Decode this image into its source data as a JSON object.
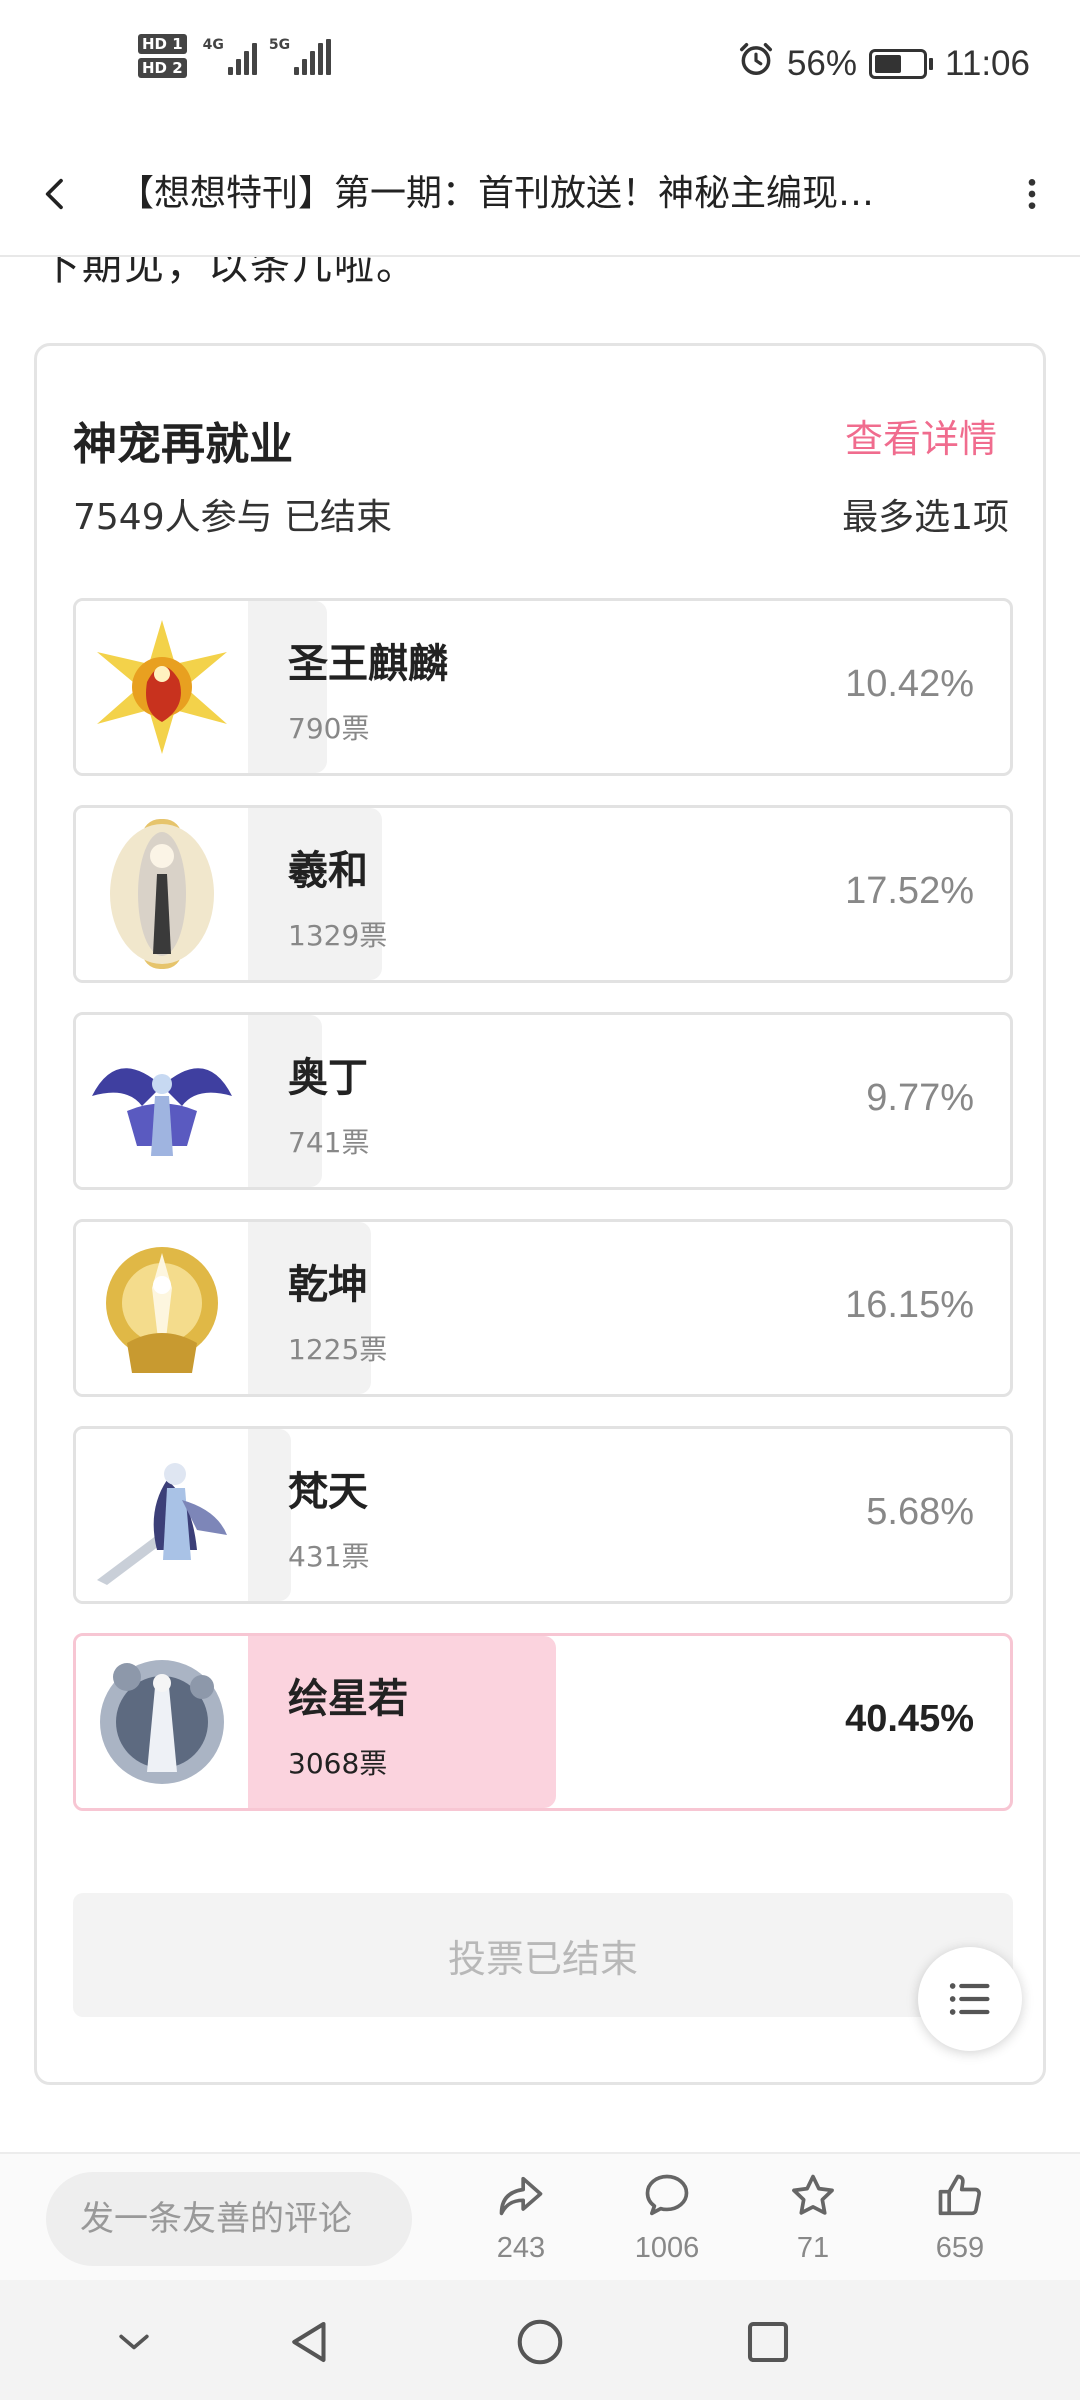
{
  "status_bar": {
    "sim1": "HD 1",
    "sim2": "HD 2",
    "net1": "4G",
    "net2": "5G",
    "battery_pct": "56%",
    "battery_level": 0.56,
    "time": "11:06",
    "icons": [
      "alarm-icon",
      "battery-icon",
      "signal-icon"
    ]
  },
  "header": {
    "title": "【想想特刊】第一期：首刊放送！神秘主编现…"
  },
  "content": {
    "cut_text": "下期见，以条几啦。"
  },
  "poll": {
    "title": "神宠再就业",
    "detail_link": "查看详情",
    "participants": "7549人参与 已结束",
    "rule": "最多选1项",
    "options": [
      {
        "name": "圣王麒麟",
        "votes": "790票",
        "percent": "10.42%",
        "share": 0.1042
      },
      {
        "name": "羲和",
        "votes": "1329票",
        "percent": "17.52%",
        "share": 0.1752
      },
      {
        "name": "奥丁",
        "votes": "741票",
        "percent": "9.77%",
        "share": 0.0977
      },
      {
        "name": "乾坤",
        "votes": "1225票",
        "percent": "16.15%",
        "share": 0.1615
      },
      {
        "name": "梵天",
        "votes": "431票",
        "percent": "5.68%",
        "share": 0.0568
      },
      {
        "name": "绘星若",
        "votes": "3068票",
        "percent": "40.45%",
        "share": 0.4045
      }
    ],
    "ended_label": "投票已结束"
  },
  "action_bar": {
    "comment_placeholder": "发一条友善的评论",
    "share_count": "243",
    "comment_count": "1006",
    "favorite_count": "71",
    "like_count": "659"
  },
  "colors": {
    "accent": "#f06c8e",
    "winner_fill": "#fbd3de",
    "bar_fill": "#f2f2f2"
  }
}
